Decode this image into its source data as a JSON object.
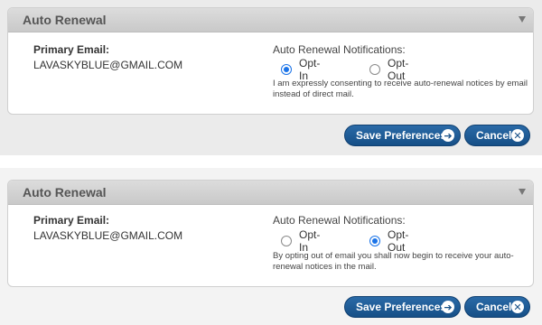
{
  "panels": [
    {
      "title": "Auto Renewal",
      "email_label": "Primary Email:",
      "email_value": "LAVASKYBLUE@GMAIL.COM",
      "notifications_label": "Auto Renewal Notifications:",
      "options": [
        {
          "label": "Opt-In",
          "checked": true
        },
        {
          "label": "Opt-Out",
          "checked": false
        }
      ],
      "note": "I am expressly consenting to receive auto-renewal notices by email instead of direct mail."
    },
    {
      "title": "Auto Renewal",
      "email_label": "Primary Email:",
      "email_value": "LAVASKYBLUE@GMAIL.COM",
      "notifications_label": "Auto Renewal Notifications:",
      "options": [
        {
          "label": "Opt-In",
          "checked": false
        },
        {
          "label": "Opt-Out",
          "checked": true
        }
      ],
      "note": "By opting out of email you shall now begin to receive your auto-renewal notices in the mail."
    }
  ],
  "buttons": {
    "save_label": "Save Preferences",
    "cancel_label": "Cancel"
  },
  "icons": {
    "save": "arrow-right-circle-icon",
    "cancel": "close-circle-icon",
    "collapse": "triangle-down-icon"
  },
  "colors": {
    "button": "#1b5a95",
    "radio_checked": "#1a73e8"
  }
}
